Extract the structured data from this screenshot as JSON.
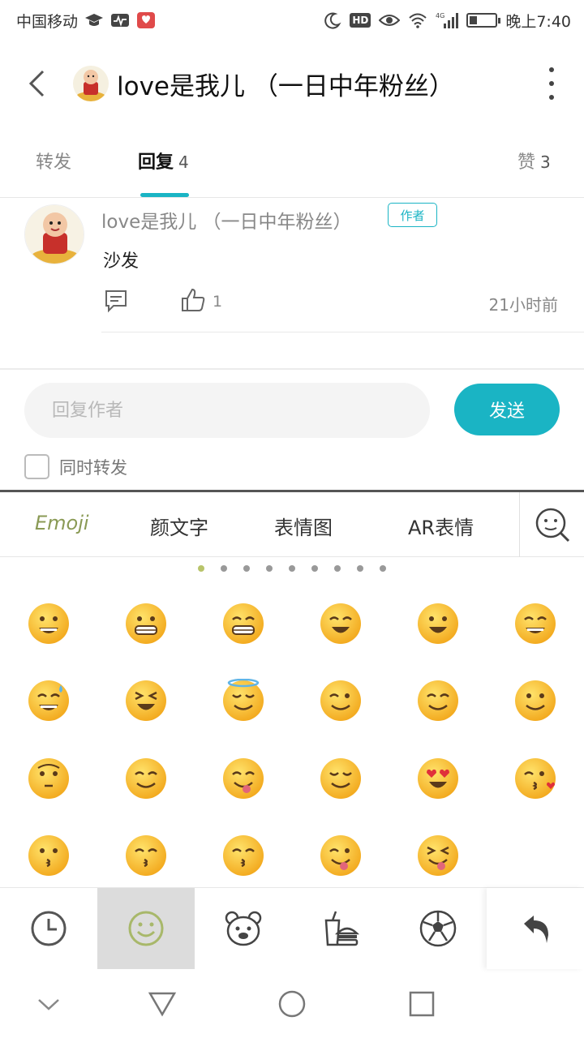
{
  "status_bar": {
    "carrier": "中国移动",
    "network": "4G",
    "time": "晚上7:40",
    "battery_level": 0.3
  },
  "header": {
    "title": "love是我儿 （一日中年粉丝）"
  },
  "tabs": [
    {
      "label": "转发",
      "count": ""
    },
    {
      "label": "回复",
      "count": "4"
    },
    {
      "label": "赞",
      "count": "3"
    }
  ],
  "comment": {
    "author": "love是我儿 （一日中年粉丝）",
    "badge": "作者",
    "text": "沙发",
    "likes": "1",
    "time": "21小时前"
  },
  "reply": {
    "placeholder": "回复作者",
    "send_label": "发送",
    "forward_label": "同时转发"
  },
  "emoji_panel": {
    "tabs": [
      "Emoji",
      "颜文字",
      "表情图",
      "AR表情"
    ],
    "active_tab": "Emoji",
    "page_count": 9,
    "active_page": 0,
    "categories": [
      "recent-icon",
      "smiley-icon",
      "bear-icon",
      "food-icon",
      "soccer-ball-icon",
      "undo-icon"
    ]
  },
  "colors": {
    "accent": "#1ab4c4",
    "emoji_tab_active": "#8a9a55"
  }
}
